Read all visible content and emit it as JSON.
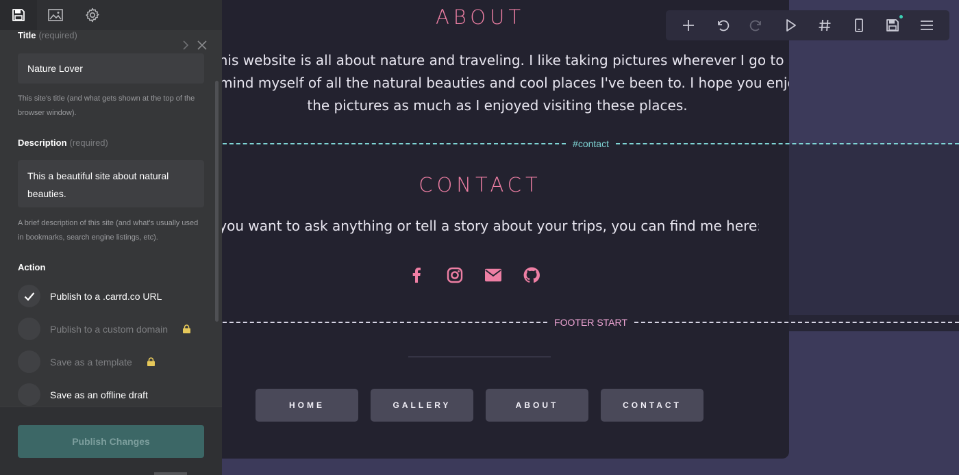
{
  "site": {
    "about_heading": "ABOUT",
    "about_lines": [
      "This website is all about nature and traveling. I like taking pictures wherever I go to",
      "remind myself of all the natural beauties and cool places I've been to. I hope you enjoy",
      "the pictures as much as I enjoyed visiting these places."
    ],
    "contact_marker": "#contact",
    "contact_heading": "CONTACT",
    "contact_text": "If you want to ask anything or tell a story about your trips, you can find me here:",
    "social_icons": [
      "facebook-icon",
      "instagram-icon",
      "email-icon",
      "github-icon"
    ],
    "footer_marker": "FOOTER START",
    "nav_buttons": [
      "HOME",
      "GALLERY",
      "ABOUT",
      "CONTACT"
    ],
    "colors": {
      "accent": "#ee7fa4",
      "background": "#23222f",
      "marker": "#7fd6d6"
    }
  },
  "toolbar": {
    "icons": [
      "add-icon",
      "undo-icon",
      "redo-icon",
      "play-icon",
      "hash-icon",
      "mobile-icon",
      "save-icon",
      "menu-icon"
    ]
  },
  "panel": {
    "tabs": [
      "save-icon",
      "image-icon",
      "gear-icon"
    ],
    "title_label": "Title",
    "title_required": "(required)",
    "title_value": "Nature Lover",
    "title_help": "This site's title (and what gets shown at the top of the browser window).",
    "description_label": "Description",
    "description_required": "(required)",
    "description_value": "This a beautiful site about natural beauties.",
    "description_help": "A brief description of this site (and what's usually used in bookmarks, search engine listings, etc).",
    "action_label": "Action",
    "actions": [
      {
        "label": "Publish to a .carrd.co URL",
        "checked": true,
        "locked": false
      },
      {
        "label": "Publish to a custom domain",
        "checked": false,
        "locked": true
      },
      {
        "label": "Save as a template",
        "checked": false,
        "locked": true
      },
      {
        "label": "Save as an offline draft",
        "checked": false,
        "locked": false
      }
    ],
    "publish_button": "Publish Changes",
    "publish_color": "#3c6766"
  }
}
